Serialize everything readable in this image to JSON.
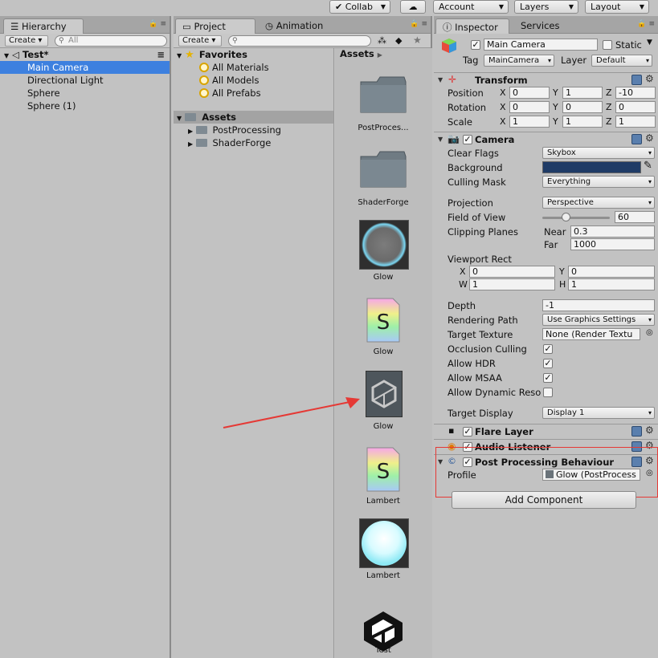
{
  "toolbar": {
    "collab": "Collab",
    "account": "Account",
    "layers": "Layers",
    "layout": "Layout"
  },
  "hierarchy": {
    "tab": "Hierarchy",
    "create": "Create",
    "search_placeholder": "All",
    "scene": "Test*",
    "items": [
      "Main Camera",
      "Directional Light",
      "Sphere",
      "Sphere (1)"
    ]
  },
  "project": {
    "tab": "Project",
    "tab2": "Animation",
    "create": "Create",
    "favorites": "Favorites",
    "favorite_items": [
      "All Materials",
      "All Models",
      "All Prefabs"
    ],
    "assets": "Assets",
    "asset_folders": [
      "PostProcessing",
      "ShaderForge"
    ],
    "breadcrumb": "Assets",
    "grid": [
      {
        "label": "PostProces...",
        "kind": "folder"
      },
      {
        "label": "ShaderForge",
        "kind": "folder"
      },
      {
        "label": "Glow",
        "kind": "material-glow"
      },
      {
        "label": "Glow",
        "kind": "shader"
      },
      {
        "label": "Glow",
        "kind": "unity-asset"
      },
      {
        "label": "Lambert",
        "kind": "shader"
      },
      {
        "label": "Lambert",
        "kind": "material-lambert"
      },
      {
        "label": "Test",
        "kind": "unity-scene"
      }
    ]
  },
  "inspector": {
    "tab": "Inspector",
    "tab2": "Services",
    "object_name": "Main Camera",
    "static_label": "Static",
    "tag_label": "Tag",
    "tag_value": "MainCamera",
    "layer_label": "Layer",
    "layer_value": "Default",
    "transform": {
      "title": "Transform",
      "position_label": "Position",
      "rotation_label": "Rotation",
      "scale_label": "Scale",
      "position": [
        "0",
        "1",
        "-10"
      ],
      "rotation": [
        "0",
        "0",
        "0"
      ],
      "scale": [
        "1",
        "1",
        "1"
      ],
      "axes": [
        "X",
        "Y",
        "Z"
      ]
    },
    "camera": {
      "title": "Camera",
      "clear_flags_label": "Clear Flags",
      "clear_flags": "Skybox",
      "background_label": "Background",
      "background_color": "#1f3b66",
      "culling_mask_label": "Culling Mask",
      "culling_mask": "Everything",
      "projection_label": "Projection",
      "projection": "Perspective",
      "fov_label": "Field of View",
      "fov": "60",
      "fov_slider_fraction": 0.35,
      "clipping_label": "Clipping Planes",
      "near_label": "Near",
      "near": "0.3",
      "far_label": "Far",
      "far": "1000",
      "viewport_label": "Viewport Rect",
      "vp_x_label": "X",
      "vp_x": "0",
      "vp_y_label": "Y",
      "vp_y": "0",
      "vp_w_label": "W",
      "vp_w": "1",
      "vp_h_label": "H",
      "vp_h": "1",
      "depth_label": "Depth",
      "depth": "-1",
      "rendering_path_label": "Rendering Path",
      "rendering_path": "Use Graphics Settings",
      "target_texture_label": "Target Texture",
      "target_texture": "None (Render Textu",
      "occlusion_label": "Occlusion Culling",
      "hdr_label": "Allow HDR",
      "msaa_label": "Allow MSAA",
      "dynres_label": "Allow Dynamic Reso",
      "target_display_label": "Target Display",
      "target_display": "Display 1"
    },
    "flare_layer": "Flare Layer",
    "audio_listener": "Audio Listener",
    "post_processing": {
      "title": "Post Processing Behaviour",
      "profile_label": "Profile",
      "profile_value": "Glow (PostProcess"
    },
    "add_component": "Add Component"
  }
}
